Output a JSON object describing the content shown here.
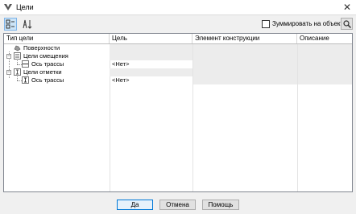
{
  "window": {
    "title": "Цели"
  },
  "toolbar": {
    "sort_categorized_icon": "categorized-sort-icon",
    "sort_alpha_icon": "alphabetical-sort-icon",
    "zoom_checkbox_label": "Зуммировать на объекте",
    "zoom_checkbox_checked": false
  },
  "grid": {
    "columns": [
      "Тип цели",
      "Цель",
      "Элемент конструкции",
      "Описание"
    ],
    "rows": [
      {
        "label": "Поверхности",
        "target": "",
        "element": "",
        "description": "",
        "icon": "surfaces-icon",
        "expander": "",
        "shaded": true
      },
      {
        "label": "Цели смещения",
        "target": "",
        "element": "",
        "description": "",
        "icon": "offset-targets-icon",
        "expander": "−",
        "shaded": true
      },
      {
        "label": "Ось трассы",
        "target": "<Нет>",
        "element": "",
        "description": "",
        "icon": "alignment-icon",
        "expander": "",
        "shaded": false
      },
      {
        "label": "Цели отметки",
        "target": "",
        "element": "",
        "description": "",
        "icon": "elevation-targets-icon",
        "expander": "−",
        "shaded": true
      },
      {
        "label": "Ось трассы",
        "target": "<Нет>",
        "element": "",
        "description": "",
        "icon": "alignment-icon",
        "expander": "",
        "shaded": false
      }
    ]
  },
  "buttons": {
    "ok": "Да",
    "cancel": "Отмена",
    "help": "Помощь"
  }
}
